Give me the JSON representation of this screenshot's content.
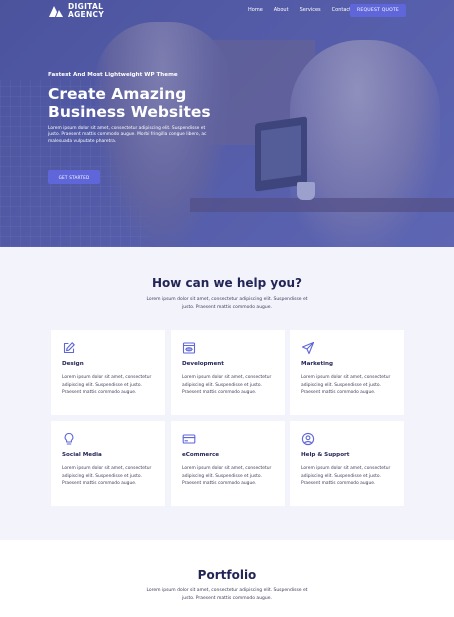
{
  "header": {
    "logo_line1": "DIGITAL",
    "logo_line2": "AGENCY",
    "nav": [
      "Home",
      "About",
      "Services",
      "Contact"
    ],
    "cta": "REQUEST QUOTE"
  },
  "hero": {
    "eyebrow": "Fastest And Most Lightweight WP Theme",
    "title": "Create Amazing Business Websites",
    "text": "Lorem ipsum dolor sit amet, consectetur adipiscing elit. Suspendisse et justo. Praesent mattis commodo augue. Morbi fringilla congue libero, ac malesuada vulputate pharetra.",
    "button": "GET STARTED"
  },
  "services": {
    "title": "How can we help you?",
    "subtitle": "Lorem ipsum dolor sit amet, consectetur adipiscing elit. Suspendisse et justo. Praesent mattis commodo augue.",
    "items": [
      {
        "title": "Design",
        "icon": "pencil-square-icon",
        "text": "Lorem ipsum dolor sit amet, consectetur adipiscing elit. Suspendisse et justo. Praesent mattis commodo augue."
      },
      {
        "title": "Development",
        "icon": "code-window-icon",
        "text": "Lorem ipsum dolor sit amet, consectetur adipiscing elit. Suspendisse et justo. Praesent mattis commodo augue."
      },
      {
        "title": "Marketing",
        "icon": "paper-plane-icon",
        "text": "Lorem ipsum dolor sit amet, consectetur adipiscing elit. Suspendisse et justo. Praesent mattis commodo augue."
      },
      {
        "title": "Social Media",
        "icon": "lightbulb-icon",
        "text": "Lorem ipsum dolor sit amet, consectetur adipiscing elit. Suspendisse et justo. Praesent mattis commodo augue."
      },
      {
        "title": "eCommerce",
        "icon": "credit-card-icon",
        "text": "Lorem ipsum dolor sit amet, consectetur adipiscing elit. Suspendisse et justo. Praesent mattis commodo augue."
      },
      {
        "title": "Help & Support",
        "icon": "user-circle-icon",
        "text": "Lorem ipsum dolor sit amet, consectetur adipiscing elit. Suspendisse et justo. Praesent mattis commodo augue."
      }
    ]
  },
  "portfolio": {
    "title": "Portfolio",
    "subtitle": "Lorem ipsum dolor sit amet, consectetur adipiscing elit. Suspendisse et justo. Praesent mattis commodo augue."
  },
  "colors": {
    "accent": "#5e66d9",
    "heading": "#232556",
    "section_bg": "#f2f3fb",
    "hero_overlay": "#4e559c"
  }
}
